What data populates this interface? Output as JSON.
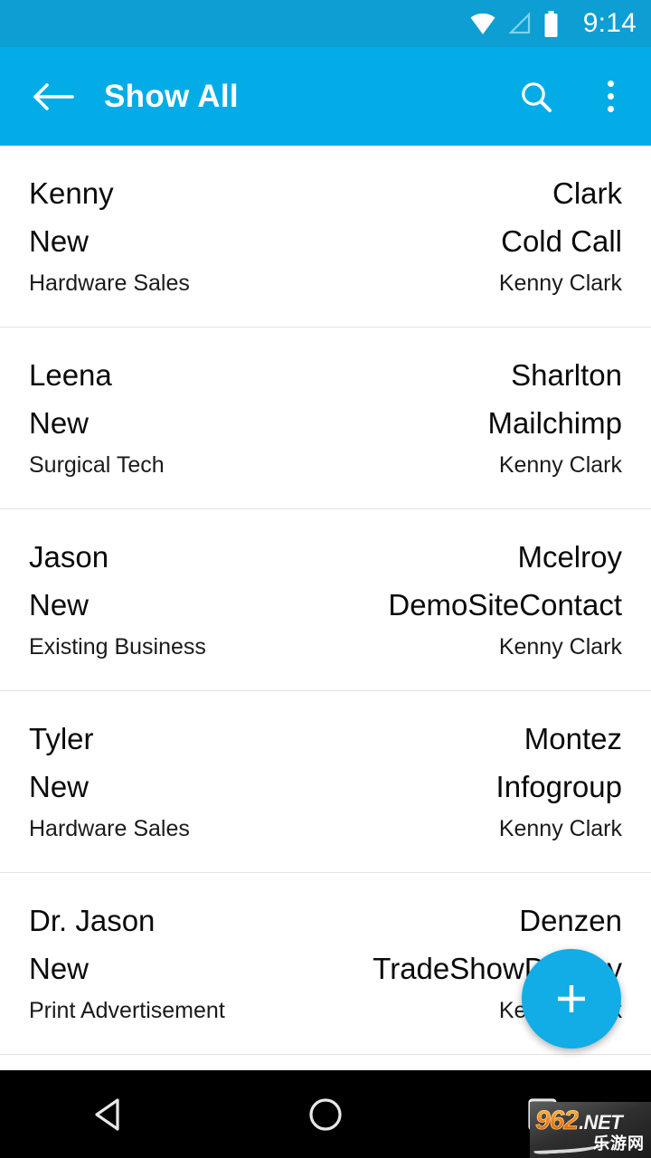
{
  "status_bar": {
    "background": "#0d9ed3",
    "clock": "9:14",
    "icons": [
      "wifi-icon",
      "cell-signal-icon",
      "battery-icon"
    ]
  },
  "toolbar": {
    "background": "#03ace7",
    "back_icon": "arrow-left-icon",
    "title": "Show All",
    "search_icon": "search-icon",
    "overflow_icon": "overflow-menu-icon"
  },
  "list": {
    "rows": [
      {
        "first_name": "Kenny",
        "last_name": "Clark",
        "status": "New",
        "source": "Cold Call",
        "category": "Hardware Sales",
        "owner": "Kenny Clark"
      },
      {
        "first_name": "Leena",
        "last_name": "Sharlton",
        "status": "New",
        "source": "Mailchimp",
        "category": "Surgical Tech",
        "owner": "Kenny Clark"
      },
      {
        "first_name": "Jason",
        "last_name": "Mcelroy",
        "status": "New",
        "source": "DemoSiteContact",
        "category": "Existing Business",
        "owner": "Kenny Clark"
      },
      {
        "first_name": "Tyler",
        "last_name": "Montez",
        "status": "New",
        "source": "Infogroup",
        "category": "Hardware Sales",
        "owner": "Kenny Clark"
      },
      {
        "first_name": "Dr. Jason",
        "last_name": "Denzen",
        "status": "New",
        "source": "TradeShowDisplay",
        "category": "Print Advertisement",
        "owner": "Kenny Clark"
      }
    ]
  },
  "fab": {
    "icon": "plus-icon",
    "color": "#12ace6"
  },
  "nav_bar": {
    "background": "#000000",
    "back_icon": "nav-back-triangle-icon",
    "home_icon": "nav-home-circle-icon",
    "recents_icon": "nav-recents-square-icon"
  },
  "watermark": {
    "number": "962",
    "domain": ".NET",
    "chinese": "乐游网"
  }
}
